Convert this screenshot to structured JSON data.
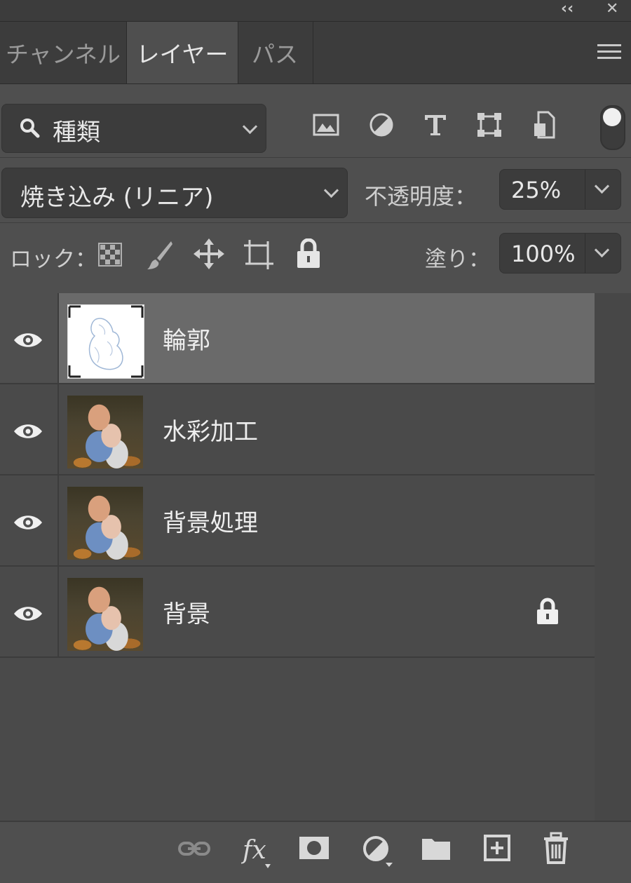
{
  "window_controls": {
    "collapse": "‹‹",
    "close": "✕"
  },
  "tabs": [
    {
      "label": "チャンネル",
      "active": false
    },
    {
      "label": "レイヤー",
      "active": true
    },
    {
      "label": "パス",
      "active": false
    }
  ],
  "filter": {
    "value": "種類"
  },
  "blend_mode": {
    "value": "焼き込み (リニア)"
  },
  "opacity": {
    "label": "不透明度：",
    "value": "25%"
  },
  "lock": {
    "label": "ロック："
  },
  "fill": {
    "label": "塗り：",
    "value": "100%"
  },
  "layers": [
    {
      "name": "輪郭",
      "selected": true,
      "locked": false,
      "visible": true,
      "thumbnail": "sketch"
    },
    {
      "name": "水彩加工",
      "selected": false,
      "locked": false,
      "visible": true,
      "thumbnail": "photo"
    },
    {
      "name": "背景処理",
      "selected": false,
      "locked": false,
      "visible": true,
      "thumbnail": "photo"
    },
    {
      "name": "背景",
      "selected": false,
      "locked": true,
      "visible": true,
      "thumbnail": "photo"
    }
  ],
  "footer_icons": [
    "link-layers-icon",
    "fx-icon",
    "layer-mask-icon",
    "adjustment-layer-icon",
    "group-folder-icon",
    "new-layer-icon",
    "delete-icon"
  ],
  "colors": {
    "panel_bg": "#4f4f4f",
    "tab_bar": "#3c3c3c",
    "selected_layer": "#6a6a6a"
  }
}
